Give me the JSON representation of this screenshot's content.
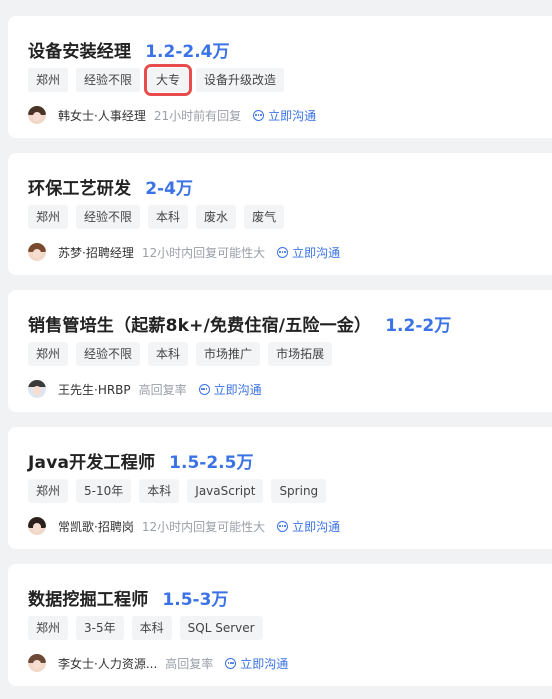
{
  "jobs": [
    {
      "title": "设备安装经理",
      "salary": "1.2-2.4万",
      "tags": [
        "郑州",
        "经验不限",
        "大专",
        "设备升级改造"
      ],
      "recruiter": "韩女士·人事经理",
      "reply": "21小时前有回复",
      "chat_label": "立即沟通"
    },
    {
      "title": "环保工艺研发",
      "salary": "2-4万",
      "tags": [
        "郑州",
        "经验不限",
        "本科",
        "废水",
        "废气"
      ],
      "recruiter": "苏梦·招聘经理",
      "reply": "12小时内回复可能性大",
      "chat_label": "立即沟通"
    },
    {
      "title": "销售管培生（起薪8k+/免费住宿/五险一金）",
      "salary": "1.2-2万",
      "tags": [
        "郑州",
        "经验不限",
        "本科",
        "市场推广",
        "市场拓展"
      ],
      "recruiter": "王先生·HRBP",
      "reply": "高回复率",
      "chat_label": "立即沟通"
    },
    {
      "title": "Java开发工程师",
      "salary": "1.5-2.5万",
      "tags": [
        "郑州",
        "5-10年",
        "本科",
        "JavaScript",
        "Spring"
      ],
      "recruiter": "常凯歌·招聘岗",
      "reply": "12小时内回复可能性大",
      "chat_label": "立即沟通"
    },
    {
      "title": "数据挖掘工程师",
      "salary": "1.5-3万",
      "tags": [
        "郑州",
        "3-5年",
        "本科",
        "SQL Server"
      ],
      "recruiter": "李女士·人力资源...",
      "reply": "高回复率",
      "chat_label": "立即沟通"
    }
  ]
}
